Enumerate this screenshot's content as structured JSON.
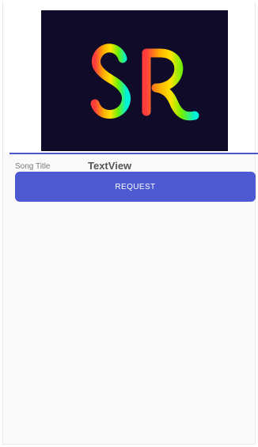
{
  "song": {
    "label": "Song Title",
    "value": "TextView"
  },
  "actions": {
    "request_label": "REQUEST"
  },
  "logo": {
    "background_color": "#0f0b29",
    "gradient_colors": [
      "#ff3d3d",
      "#ffb000",
      "#ffe300",
      "#72f000",
      "#00f0d8"
    ]
  },
  "theme": {
    "accent_color": "#4c59d0"
  }
}
